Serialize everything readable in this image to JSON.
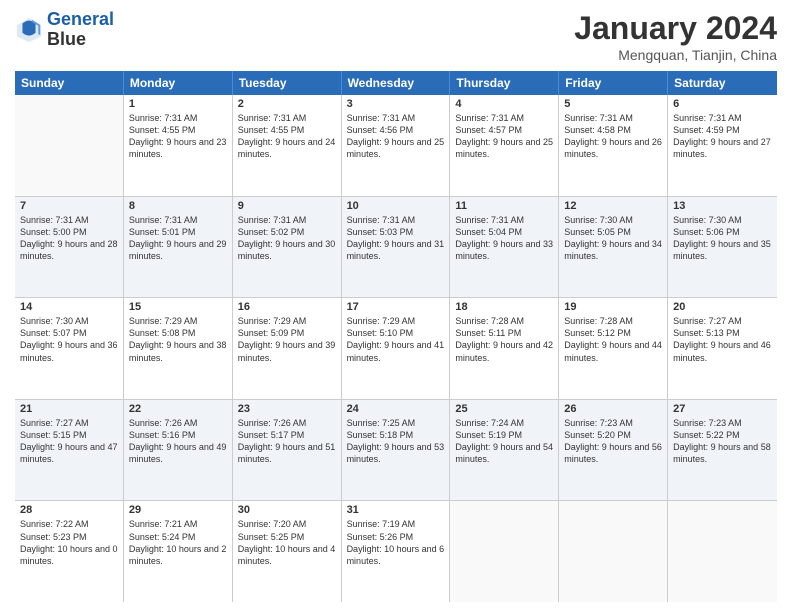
{
  "header": {
    "logo_line1": "General",
    "logo_line2": "Blue",
    "title": "January 2024",
    "subtitle": "Mengquan, Tianjin, China"
  },
  "days_of_week": [
    "Sunday",
    "Monday",
    "Tuesday",
    "Wednesday",
    "Thursday",
    "Friday",
    "Saturday"
  ],
  "weeks": [
    [
      {
        "day": "",
        "sunrise": "",
        "sunset": "",
        "daylight": ""
      },
      {
        "day": "1",
        "sunrise": "Sunrise: 7:31 AM",
        "sunset": "Sunset: 4:55 PM",
        "daylight": "Daylight: 9 hours and 23 minutes."
      },
      {
        "day": "2",
        "sunrise": "Sunrise: 7:31 AM",
        "sunset": "Sunset: 4:55 PM",
        "daylight": "Daylight: 9 hours and 24 minutes."
      },
      {
        "day": "3",
        "sunrise": "Sunrise: 7:31 AM",
        "sunset": "Sunset: 4:56 PM",
        "daylight": "Daylight: 9 hours and 25 minutes."
      },
      {
        "day": "4",
        "sunrise": "Sunrise: 7:31 AM",
        "sunset": "Sunset: 4:57 PM",
        "daylight": "Daylight: 9 hours and 25 minutes."
      },
      {
        "day": "5",
        "sunrise": "Sunrise: 7:31 AM",
        "sunset": "Sunset: 4:58 PM",
        "daylight": "Daylight: 9 hours and 26 minutes."
      },
      {
        "day": "6",
        "sunrise": "Sunrise: 7:31 AM",
        "sunset": "Sunset: 4:59 PM",
        "daylight": "Daylight: 9 hours and 27 minutes."
      }
    ],
    [
      {
        "day": "7",
        "sunrise": "Sunrise: 7:31 AM",
        "sunset": "Sunset: 5:00 PM",
        "daylight": "Daylight: 9 hours and 28 minutes."
      },
      {
        "day": "8",
        "sunrise": "Sunrise: 7:31 AM",
        "sunset": "Sunset: 5:01 PM",
        "daylight": "Daylight: 9 hours and 29 minutes."
      },
      {
        "day": "9",
        "sunrise": "Sunrise: 7:31 AM",
        "sunset": "Sunset: 5:02 PM",
        "daylight": "Daylight: 9 hours and 30 minutes."
      },
      {
        "day": "10",
        "sunrise": "Sunrise: 7:31 AM",
        "sunset": "Sunset: 5:03 PM",
        "daylight": "Daylight: 9 hours and 31 minutes."
      },
      {
        "day": "11",
        "sunrise": "Sunrise: 7:31 AM",
        "sunset": "Sunset: 5:04 PM",
        "daylight": "Daylight: 9 hours and 33 minutes."
      },
      {
        "day": "12",
        "sunrise": "Sunrise: 7:30 AM",
        "sunset": "Sunset: 5:05 PM",
        "daylight": "Daylight: 9 hours and 34 minutes."
      },
      {
        "day": "13",
        "sunrise": "Sunrise: 7:30 AM",
        "sunset": "Sunset: 5:06 PM",
        "daylight": "Daylight: 9 hours and 35 minutes."
      }
    ],
    [
      {
        "day": "14",
        "sunrise": "Sunrise: 7:30 AM",
        "sunset": "Sunset: 5:07 PM",
        "daylight": "Daylight: 9 hours and 36 minutes."
      },
      {
        "day": "15",
        "sunrise": "Sunrise: 7:29 AM",
        "sunset": "Sunset: 5:08 PM",
        "daylight": "Daylight: 9 hours and 38 minutes."
      },
      {
        "day": "16",
        "sunrise": "Sunrise: 7:29 AM",
        "sunset": "Sunset: 5:09 PM",
        "daylight": "Daylight: 9 hours and 39 minutes."
      },
      {
        "day": "17",
        "sunrise": "Sunrise: 7:29 AM",
        "sunset": "Sunset: 5:10 PM",
        "daylight": "Daylight: 9 hours and 41 minutes."
      },
      {
        "day": "18",
        "sunrise": "Sunrise: 7:28 AM",
        "sunset": "Sunset: 5:11 PM",
        "daylight": "Daylight: 9 hours and 42 minutes."
      },
      {
        "day": "19",
        "sunrise": "Sunrise: 7:28 AM",
        "sunset": "Sunset: 5:12 PM",
        "daylight": "Daylight: 9 hours and 44 minutes."
      },
      {
        "day": "20",
        "sunrise": "Sunrise: 7:27 AM",
        "sunset": "Sunset: 5:13 PM",
        "daylight": "Daylight: 9 hours and 46 minutes."
      }
    ],
    [
      {
        "day": "21",
        "sunrise": "Sunrise: 7:27 AM",
        "sunset": "Sunset: 5:15 PM",
        "daylight": "Daylight: 9 hours and 47 minutes."
      },
      {
        "day": "22",
        "sunrise": "Sunrise: 7:26 AM",
        "sunset": "Sunset: 5:16 PM",
        "daylight": "Daylight: 9 hours and 49 minutes."
      },
      {
        "day": "23",
        "sunrise": "Sunrise: 7:26 AM",
        "sunset": "Sunset: 5:17 PM",
        "daylight": "Daylight: 9 hours and 51 minutes."
      },
      {
        "day": "24",
        "sunrise": "Sunrise: 7:25 AM",
        "sunset": "Sunset: 5:18 PM",
        "daylight": "Daylight: 9 hours and 53 minutes."
      },
      {
        "day": "25",
        "sunrise": "Sunrise: 7:24 AM",
        "sunset": "Sunset: 5:19 PM",
        "daylight": "Daylight: 9 hours and 54 minutes."
      },
      {
        "day": "26",
        "sunrise": "Sunrise: 7:23 AM",
        "sunset": "Sunset: 5:20 PM",
        "daylight": "Daylight: 9 hours and 56 minutes."
      },
      {
        "day": "27",
        "sunrise": "Sunrise: 7:23 AM",
        "sunset": "Sunset: 5:22 PM",
        "daylight": "Daylight: 9 hours and 58 minutes."
      }
    ],
    [
      {
        "day": "28",
        "sunrise": "Sunrise: 7:22 AM",
        "sunset": "Sunset: 5:23 PM",
        "daylight": "Daylight: 10 hours and 0 minutes."
      },
      {
        "day": "29",
        "sunrise": "Sunrise: 7:21 AM",
        "sunset": "Sunset: 5:24 PM",
        "daylight": "Daylight: 10 hours and 2 minutes."
      },
      {
        "day": "30",
        "sunrise": "Sunrise: 7:20 AM",
        "sunset": "Sunset: 5:25 PM",
        "daylight": "Daylight: 10 hours and 4 minutes."
      },
      {
        "day": "31",
        "sunrise": "Sunrise: 7:19 AM",
        "sunset": "Sunset: 5:26 PM",
        "daylight": "Daylight: 10 hours and 6 minutes."
      },
      {
        "day": "",
        "sunrise": "",
        "sunset": "",
        "daylight": ""
      },
      {
        "day": "",
        "sunrise": "",
        "sunset": "",
        "daylight": ""
      },
      {
        "day": "",
        "sunrise": "",
        "sunset": "",
        "daylight": ""
      }
    ]
  ]
}
